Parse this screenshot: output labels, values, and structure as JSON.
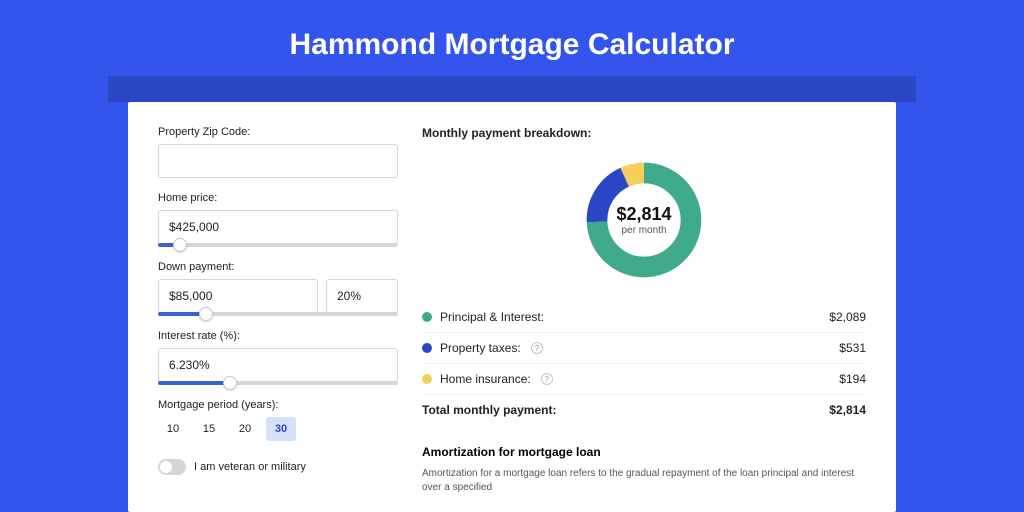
{
  "page_title": "Hammond Mortgage Calculator",
  "form": {
    "zip_label": "Property Zip Code:",
    "zip_value": "",
    "home_price_label": "Home price:",
    "home_price_value": "$425,000",
    "home_price_slider_pct": 9,
    "down_payment_label": "Down payment:",
    "down_payment_value": "$85,000",
    "down_payment_pct": "20%",
    "down_payment_slider_pct": 20,
    "interest_label": "Interest rate (%):",
    "interest_value": "6.230%",
    "interest_slider_pct": 30,
    "period_label": "Mortgage period (years):",
    "periods": [
      "10",
      "15",
      "20",
      "30"
    ],
    "period_selected_index": 3,
    "veteran_label": "I am veteran or military"
  },
  "breakdown": {
    "title": "Monthly payment breakdown:",
    "center_amount": "$2,814",
    "center_sub": "per month",
    "items": [
      {
        "label": "Principal & Interest:",
        "value": "$2,089",
        "color": "#3fa98b",
        "info": false,
        "numeric": 2089
      },
      {
        "label": "Property taxes:",
        "value": "$531",
        "color": "#2a48c5",
        "info": true,
        "numeric": 531
      },
      {
        "label": "Home insurance:",
        "value": "$194",
        "color": "#f6cf5a",
        "info": true,
        "numeric": 194
      }
    ],
    "total_label": "Total monthly payment:",
    "total_value": "$2,814"
  },
  "amortization": {
    "title": "Amortization for mortgage loan",
    "text": "Amortization for a mortgage loan refers to the gradual repayment of the loan principal and interest over a specified"
  },
  "chart_data": {
    "type": "pie",
    "title": "Monthly payment breakdown",
    "series": [
      {
        "name": "Principal & Interest",
        "value": 2089,
        "color": "#3fa98b"
      },
      {
        "name": "Property taxes",
        "value": 531,
        "color": "#2a48c5"
      },
      {
        "name": "Home insurance",
        "value": 194,
        "color": "#f6cf5a"
      }
    ],
    "total": 2814
  }
}
